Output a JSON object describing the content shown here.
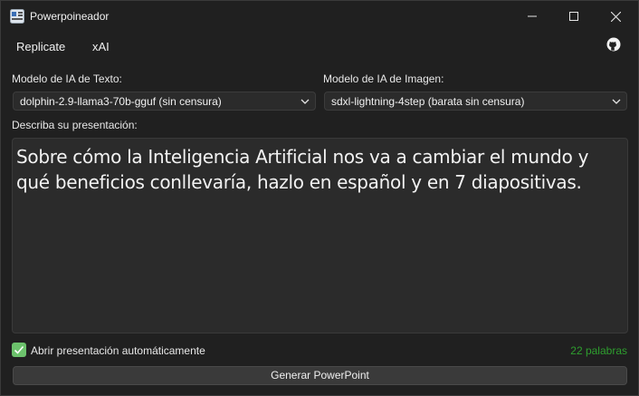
{
  "window": {
    "title": "Powerpoineador"
  },
  "menu": {
    "items": [
      "Replicate",
      "xAI"
    ]
  },
  "icons": {
    "app": "app-icon",
    "github": "github-icon",
    "minimize": "minimize-icon",
    "maximize": "maximize-icon",
    "close": "close-icon",
    "chevron": "chevron-down-icon",
    "check": "check-icon"
  },
  "text_model": {
    "label": "Modelo de IA de Texto:",
    "selected": "dolphin-2.9-llama3-70b-gguf (sin censura)"
  },
  "image_model": {
    "label": "Modelo de IA de Imagen:",
    "selected": "sdxl-lightning-4step (barata sin censura)"
  },
  "description": {
    "label": "Describa su presentación:",
    "value": "Sobre cómo la Inteligencia Artificial nos va a cambiar el mundo y qué beneficios conllevaría, hazlo en español y en 7 diapositivas."
  },
  "auto_open": {
    "label": "Abrir presentación automáticamente",
    "checked": true
  },
  "word_count": "22 palabras",
  "generate_button": "Generar PowerPoint",
  "colors": {
    "background": "#202020",
    "check_green": "#6cc26c",
    "word_count_green": "#2e9e2e"
  }
}
